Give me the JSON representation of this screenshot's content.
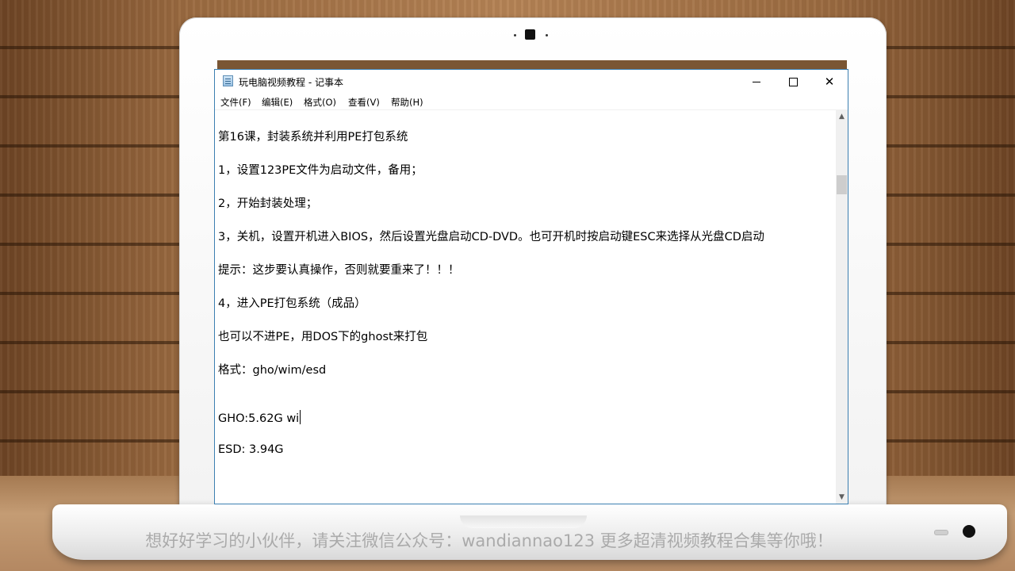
{
  "window": {
    "title": "玩电脑视频教程 - 记事本",
    "minimize_icon": "minimize-icon",
    "maximize_icon": "maximize-icon",
    "close_icon": "close-icon",
    "close_glyph": "✕"
  },
  "menu": {
    "items": [
      "文件(F)",
      "编辑(E)",
      "格式(O)",
      "查看(V)",
      "帮助(H)"
    ]
  },
  "document": {
    "lines": [
      "第16课，封装系统并利用PE打包系统",
      "1，设置123PE文件为启动文件，备用；",
      "2，开始封装处理；",
      "3，关机，设置开机进入BIOS，然后设置光盘启动CD-DVD。也可开机时按启动键ESC来选择从光盘CD启动",
      "提示：这步要认真操作，否则就要重来了！！！",
      "4，进入PE打包系统（成品）",
      "也可以不进PE，用DOS下的ghost来打包",
      "格式：gho/wim/esd",
      "GHO:5.62G wi",
      "ESD: 3.94G"
    ]
  },
  "scrollbar": {
    "up_arrow": "▲",
    "down_arrow": "▼"
  },
  "watermark": {
    "text": "想好好学习的小伙伴，请关注微信公众号：wandiannao123 更多超清视频教程合集等你哦！"
  },
  "colors": {
    "window_border": "#3c7fb1",
    "wood": "#b58355"
  }
}
